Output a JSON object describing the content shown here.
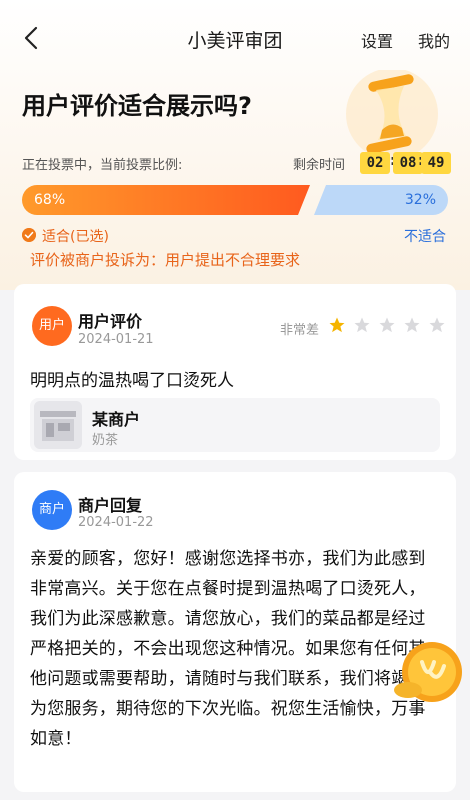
{
  "nav": {
    "title": "小美评审团",
    "settings": "设置",
    "mine": "我的"
  },
  "vote": {
    "question": "用户评价适合展示吗?",
    "status_text": "正在投票中，当前投票比例:",
    "remaining_label": "剩余时间",
    "timer": {
      "hours": "02",
      "minutes": "08",
      "seconds": "49"
    },
    "suitable_percent": "68%",
    "unsuitable_percent": "32%",
    "suitable_fraction": 0.68,
    "suitable_label": "适合(已选)",
    "unsuitable_label": "不适合"
  },
  "complaint": "评价被商户投诉为：用户提出不合理要求",
  "review": {
    "avatar_text": "用户",
    "author": "用户评价",
    "date": "2024-01-21",
    "rating_label": "非常差",
    "rating": 1,
    "rating_max": 5,
    "text": "明明点的温热喝了口烫死人",
    "merchant_name": "某商户",
    "merchant_category": "奶茶"
  },
  "reply": {
    "avatar_text": "商户",
    "author": "商户回复",
    "date": "2024-01-22",
    "text": "亲爱的顾客，您好！感谢您选择书亦，我们为此感到非常高兴。关于您在点餐时提到温热喝了口烫死人，我们为此深感歉意。请您放心，我们的菜品都是经过严格把关的，不会出现您这种情况。如果您有任何其他问题或需要帮助，请随时与我们联系，我们将竭诚为您服务，期待您的下次光临。祝您生活愉快，万事如意！"
  },
  "colors": {
    "accent_orange": "#ff6a1f",
    "accent_blue": "#2a6fdb",
    "timer_bg": "#ffd740",
    "user_avatar": "#ff6a1f",
    "merchant_avatar": "#2f7cf6"
  }
}
